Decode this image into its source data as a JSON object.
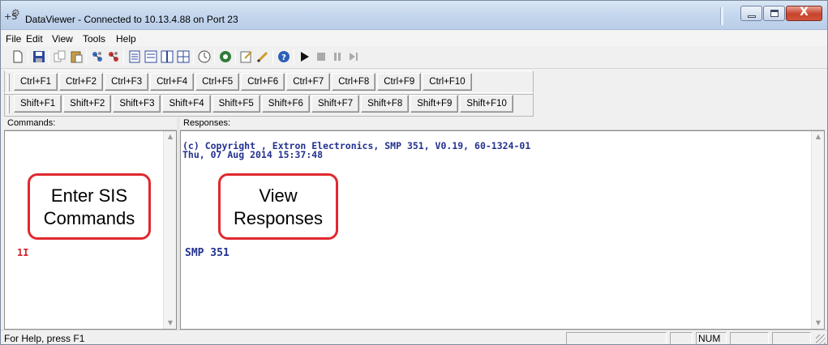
{
  "window": {
    "title": "DataViewer - Connected to 10.13.4.88 on Port 23",
    "icon_text": "+S",
    "controls": {
      "minimize": "minimize-icon",
      "maximize": "maximize-icon",
      "close": "X"
    }
  },
  "menu": [
    "File",
    "Edit",
    "View",
    "Tools",
    "Help"
  ],
  "toolbar": {
    "icons": [
      "new-file-icon",
      "save-icon",
      "copy-icon",
      "paste-icon",
      "connect-icon",
      "disconnect-icon",
      "list-icon",
      "hex-icon",
      "split-icon",
      "grid-icon",
      "clock-icon",
      "record-icon",
      "edit-icon",
      "pencil-icon",
      "help-icon",
      "play-icon",
      "stop-icon",
      "pause-icon",
      "step-icon"
    ]
  },
  "function_keys": {
    "ctrl": [
      "Ctrl+F1",
      "Ctrl+F2",
      "Ctrl+F3",
      "Ctrl+F4",
      "Ctrl+F5",
      "Ctrl+F6",
      "Ctrl+F7",
      "Ctrl+F8",
      "Ctrl+F9",
      "Ctrl+F10"
    ],
    "shift": [
      "Shift+F1",
      "Shift+F2",
      "Shift+F3",
      "Shift+F4",
      "Shift+F5",
      "Shift+F6",
      "Shift+F7",
      "Shift+F8",
      "Shift+F9",
      "Shift+F10"
    ]
  },
  "panes": {
    "commands_label": "Commands:",
    "responses_label": "Responses:",
    "command_entry": "1I",
    "response_lines": [
      "(c) Copyright , Extron Electronics, SMP 351, V0.19, 60-1324-01",
      "Thu, 07 Aug 2014 15:37:48"
    ],
    "response_entry": "SMP 351"
  },
  "callouts": {
    "commands": [
      "Enter SIS",
      "Commands"
    ],
    "responses": [
      "View",
      "Responses"
    ]
  },
  "status": {
    "help_text": "For Help, press F1",
    "num_indicator": "NUM"
  },
  "colors": {
    "command_text": "#d3232e",
    "response_text": "#23328f",
    "callout_border": "#e0282f"
  }
}
